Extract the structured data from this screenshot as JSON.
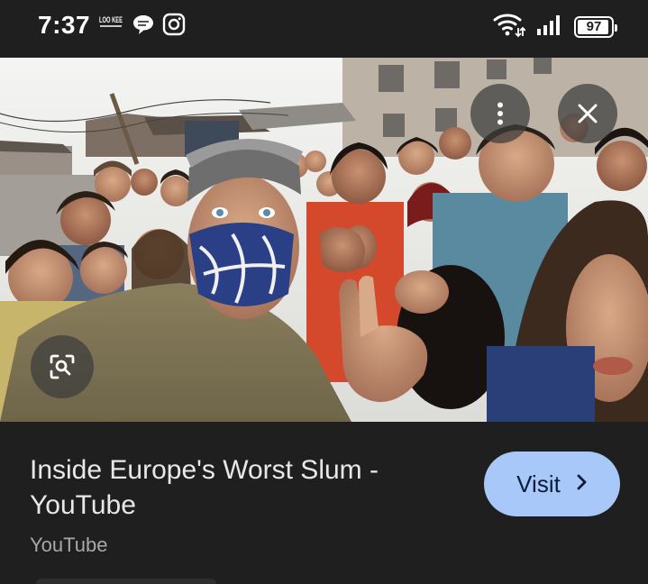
{
  "status_bar": {
    "time": "7:37",
    "app_badge": "LOO KEE",
    "battery_level": "97",
    "battery_fraction": 0.97
  },
  "icons": {
    "notif_1": "lookee-icon",
    "notif_2": "chat-bubble-icon",
    "notif_3": "instagram-icon",
    "wifi": "wifi-icon",
    "signal": "cellular-signal-icon",
    "more": "more-vertical-icon",
    "close": "close-icon",
    "lens": "lens-search-icon",
    "visit_arrow": "chevron-right-icon"
  },
  "result": {
    "title": "Inside Europe's Worst Slum - YouTube",
    "source": "YouTube",
    "visit_label": "Visit"
  },
  "colors": {
    "background": "#1f1f1f",
    "visit_button": "#a8c8fa",
    "title_text": "#e8e8e8",
    "source_text": "#a8a8a8"
  }
}
